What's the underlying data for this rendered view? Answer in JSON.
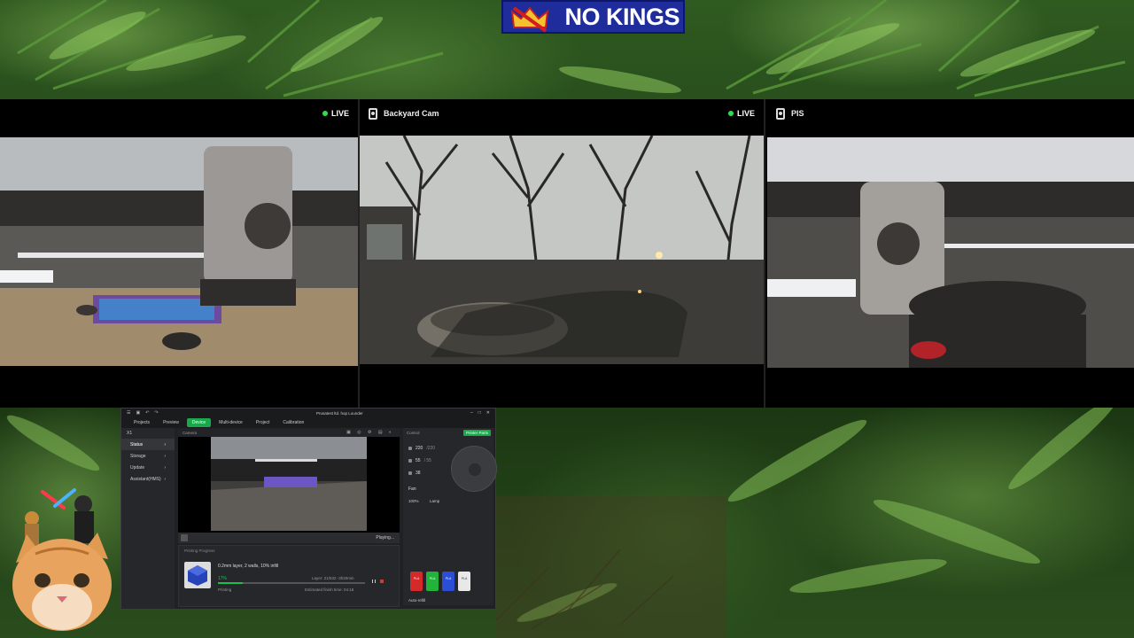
{
  "banner": {
    "text": "NO KINGS",
    "color": "#1f2c9c"
  },
  "cameras": [
    {
      "name": "",
      "live_label": "LIVE",
      "subject": "3d-printer-toolhead"
    },
    {
      "name": "Backyard Cam",
      "live_label": "LIVE",
      "subject": "backyard-fire-pit"
    },
    {
      "name": "PIS",
      "live_label": "",
      "subject": "3d-printer-bowl"
    }
  ],
  "app": {
    "window_title": "Prusatest ltd. hop Lounder",
    "tabs": [
      {
        "label": "Projects",
        "active": false
      },
      {
        "label": "Preview",
        "active": false
      },
      {
        "label": "Device",
        "active": true
      },
      {
        "label": "Multi-device",
        "active": false
      },
      {
        "label": "Project",
        "active": false
      },
      {
        "label": "Calibration",
        "active": false
      }
    ],
    "device": "X1",
    "nav": [
      {
        "label": "Status",
        "active": true
      },
      {
        "label": "Storage",
        "active": false
      },
      {
        "label": "Update",
        "active": false
      },
      {
        "label": "Assistant(HMS)",
        "active": false
      }
    ],
    "camera_panel": {
      "header": "Camera",
      "playing_label": "Playing..."
    },
    "progress": {
      "header": "Printing Progress",
      "job": "0.2mm layer, 2 walls, 10% infill",
      "percent": "17%",
      "percent_value": 0.17,
      "layer": "Layer: 21/532",
      "remaining": "-3h20min",
      "status": "Printing",
      "eta": "Estimated finish time: 04:18"
    },
    "control": {
      "header": "Control",
      "parts_button": "Printer Parts",
      "nozzle_temp": "220",
      "nozzle_target": "/220",
      "bed_temp": "55",
      "bed_target": "/ 55",
      "chamber_temp": "38",
      "fan_label": "Fan",
      "fan_percent": "100%",
      "lamp_label": "Lamp",
      "auto_refill": "Auto-refill",
      "spools": [
        {
          "label": "PLA",
          "color": "#d42a2a"
        },
        {
          "label": "PLA",
          "color": "#22b33a"
        },
        {
          "label": "PLA",
          "color": "#2a4fd4"
        },
        {
          "label": "PLA",
          "color": "#e8e8e8"
        }
      ]
    }
  },
  "kitten": {
    "description": ""
  }
}
